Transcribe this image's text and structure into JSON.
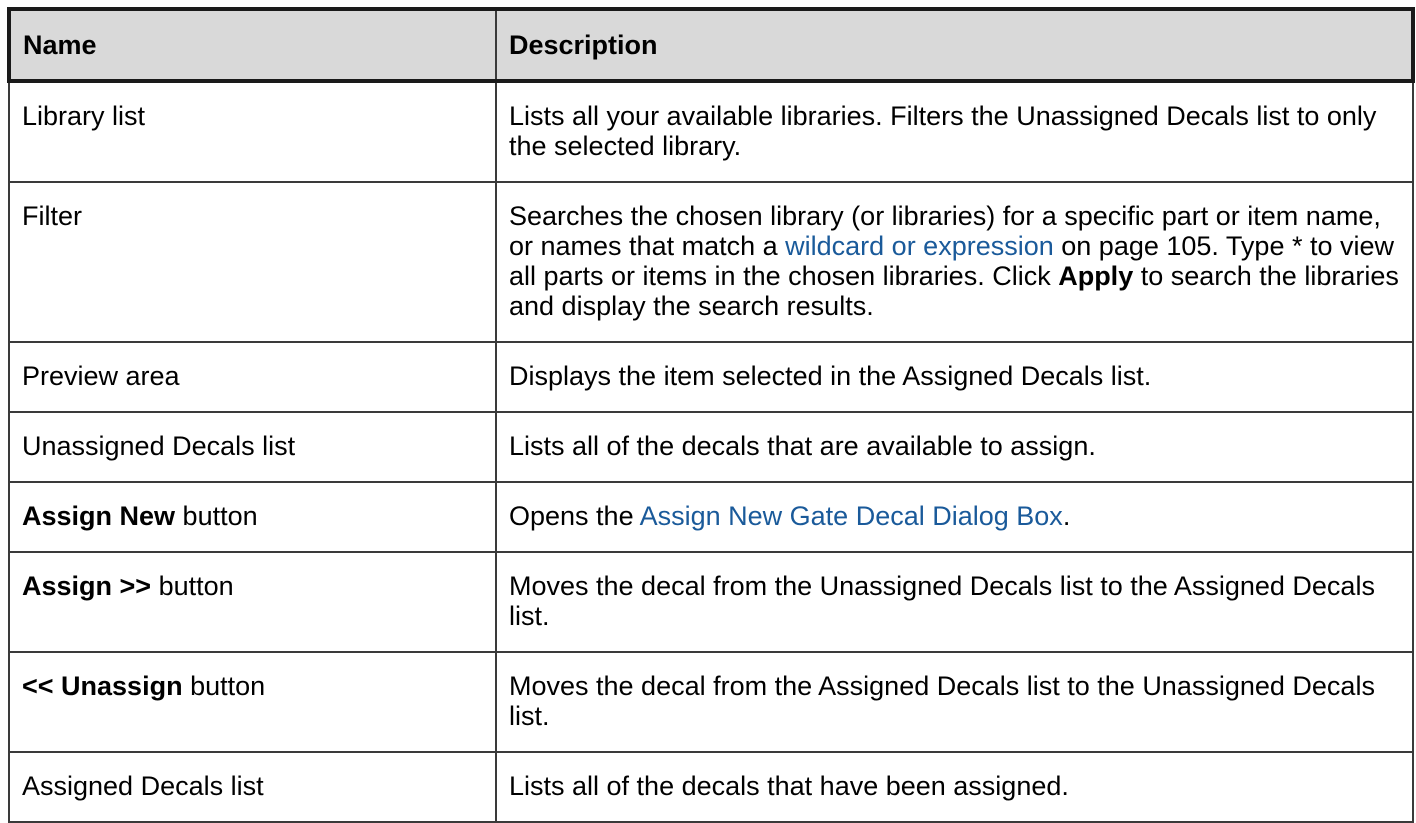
{
  "header": {
    "name": "Name",
    "description": "Description"
  },
  "rows": [
    {
      "name": "Library list",
      "desc": "Lists all your available libraries. Filters the Unassigned Decals list to only the selected library."
    },
    {
      "name": "Filter",
      "desc_pre": "Searches the chosen library (or libraries) for a specific part or item name, or names that match a ",
      "desc_link": "wildcard or expression",
      "desc_mid": " on page 105. Type * to view all parts or items in the chosen libraries. Click ",
      "desc_bold": "Apply",
      "desc_post": " to search the libraries and display the search results."
    },
    {
      "name": "Preview area",
      "desc": "Displays the item selected in the Assigned Decals list."
    },
    {
      "name": "Unassigned Decals list",
      "desc": "Lists all of the decals that are available to assign."
    },
    {
      "name_bold": "Assign New",
      "name_rest": " button",
      "desc_pre": "Opens the ",
      "desc_link": "Assign New Gate Decal Dialog Box",
      "desc_post": "."
    },
    {
      "name_bold": "Assign >>",
      "name_rest": " button",
      "desc": "Moves the decal from the Unassigned Decals list to the Assigned Decals list."
    },
    {
      "name_bold": "<< Unassign",
      "name_rest": " button",
      "desc": "Moves the decal from the Assigned Decals list to the Unassigned Decals list."
    },
    {
      "name": "Assigned Decals list",
      "desc": "Lists all of the decals that have been assigned."
    }
  ],
  "colors": {
    "header_bg": "#d9d9d9",
    "link": "#1a5a9a",
    "border": "#3a3a3a"
  }
}
